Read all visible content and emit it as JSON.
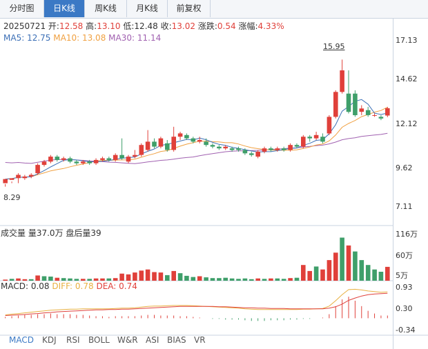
{
  "tabs": [
    {
      "label": "分时图",
      "active": false
    },
    {
      "label": "日K线",
      "active": true
    },
    {
      "label": "周K线",
      "active": false
    },
    {
      "label": "月K线",
      "active": false
    },
    {
      "label": "前复权",
      "active": false
    }
  ],
  "info": {
    "date": "20250721",
    "open_label": "开:",
    "open": "12.58",
    "high_label": "高:",
    "high": "13.10",
    "low_label": "低:",
    "low": "12.48",
    "close_label": "收:",
    "close": "13.02",
    "change_label": "涨跌:",
    "change": "0.54",
    "pct_label": "涨幅:",
    "pct": "4.33%"
  },
  "ma": {
    "ma5_label": "MA5:",
    "ma5": "12.75",
    "ma10_label": "MA10:",
    "ma10": "13.08",
    "ma30_label": "MA30:",
    "ma30": "11.14"
  },
  "volume": {
    "label": "成交量",
    "detail": "量37.0万",
    "after_label": "盘后量39"
  },
  "macd": {
    "macd_label": "MACD:",
    "macd": "0.08",
    "diff_label": "DIFF:",
    "diff": "0.78",
    "dea_label": "DEA:",
    "dea": "0.74"
  },
  "price_axis": [
    "17.13",
    "14.62",
    "12.12",
    "9.62",
    "7.11"
  ],
  "volume_axis": [
    "116万",
    "60万",
    "5万"
  ],
  "macd_axis": [
    "0.93",
    "0.30",
    "-0.34"
  ],
  "annotations": {
    "high_label": "15.95",
    "low_label": "8.29"
  },
  "bottom_tabs": [
    "MACD",
    "KDJ",
    "RSI",
    "BOLL",
    "W&R",
    "ASI",
    "BIAS",
    "VR"
  ],
  "colors": {
    "up": "#e0403a",
    "down": "#3f9f6a",
    "ma5": "#3b6fb6",
    "ma10": "#f0a040",
    "ma30": "#a060b0",
    "accent": "#3b79c5"
  },
  "chart_data": {
    "type": "candlestick",
    "price_range": [
      7.11,
      17.13
    ],
    "candles": [
      [
        8.5,
        8.75,
        8.45,
        8.29
      ],
      [
        8.7,
        8.8,
        8.6,
        8.5
      ],
      [
        8.8,
        9.0,
        9.1,
        8.5
      ],
      [
        8.8,
        8.9,
        9.0,
        8.7
      ],
      [
        8.9,
        9.0,
        9.1,
        8.8
      ],
      [
        9.1,
        9.6,
        9.7,
        9.0
      ],
      [
        9.6,
        9.8,
        9.9,
        9.5
      ],
      [
        9.8,
        10.1,
        10.2,
        9.7
      ],
      [
        10.1,
        9.9,
        10.2,
        9.8
      ],
      [
        9.9,
        10.0,
        10.1,
        9.8
      ],
      [
        10.0,
        9.8,
        10.1,
        9.7
      ],
      [
        9.8,
        9.7,
        9.9,
        9.6
      ],
      [
        9.7,
        9.8,
        9.9,
        9.6
      ],
      [
        9.8,
        9.7,
        9.9,
        9.6
      ],
      [
        9.7,
        9.9,
        10.0,
        9.6
      ],
      [
        9.9,
        10.0,
        10.1,
        9.8
      ],
      [
        10.0,
        9.9,
        10.1,
        9.8
      ],
      [
        9.9,
        10.2,
        10.3,
        9.8
      ],
      [
        10.2,
        10.0,
        11.2,
        9.9
      ],
      [
        9.8,
        10.1,
        10.2,
        9.7
      ],
      [
        10.1,
        10.2,
        10.5,
        10.0
      ],
      [
        10.2,
        10.8,
        10.9,
        10.1
      ],
      [
        10.5,
        11.0,
        11.7,
        10.4
      ],
      [
        11.0,
        10.7,
        11.2,
        10.6
      ],
      [
        10.7,
        11.2,
        11.3,
        10.6
      ],
      [
        10.9,
        10.5,
        11.1,
        10.4
      ],
      [
        10.5,
        11.3,
        11.9,
        10.4
      ],
      [
        11.3,
        11.5,
        11.6,
        11.1
      ],
      [
        11.4,
        11.2,
        11.5,
        11.1
      ],
      [
        11.2,
        11.0,
        11.3,
        10.9
      ],
      [
        11.0,
        11.1,
        11.3,
        10.9
      ],
      [
        11.0,
        10.8,
        11.2,
        10.7
      ],
      [
        10.8,
        10.7,
        10.9,
        10.6
      ],
      [
        10.7,
        10.6,
        10.8,
        10.5
      ],
      [
        10.6,
        10.7,
        10.8,
        10.5
      ],
      [
        10.6,
        10.5,
        10.7,
        10.4
      ],
      [
        10.6,
        10.5,
        10.7,
        10.4
      ],
      [
        10.5,
        10.3,
        10.6,
        10.2
      ],
      [
        10.3,
        10.2,
        10.4,
        10.1
      ],
      [
        10.1,
        10.4,
        10.5,
        10.0
      ],
      [
        10.4,
        10.6,
        10.7,
        10.3
      ],
      [
        10.6,
        10.5,
        10.7,
        10.4
      ],
      [
        10.5,
        10.6,
        10.7,
        10.4
      ],
      [
        10.6,
        10.5,
        10.7,
        10.4
      ],
      [
        10.5,
        10.8,
        10.9,
        10.4
      ],
      [
        10.8,
        10.7,
        10.9,
        10.6
      ],
      [
        10.7,
        11.3,
        11.4,
        10.6
      ],
      [
        11.3,
        11.2,
        11.4,
        11.0
      ],
      [
        11.2,
        11.4,
        11.6,
        11.1
      ],
      [
        11.3,
        11.0,
        11.5,
        10.9
      ],
      [
        11.5,
        12.5,
        12.6,
        11.4
      ],
      [
        12.5,
        14.0,
        14.1,
        12.4
      ],
      [
        14.0,
        15.3,
        15.95,
        13.9
      ],
      [
        13.9,
        12.8,
        15.3,
        12.7
      ],
      [
        13.9,
        12.6,
        14.1,
        12.5
      ],
      [
        12.8,
        13.0,
        13.2,
        12.6
      ],
      [
        12.9,
        12.6,
        13.1,
        12.5
      ],
      [
        12.6,
        12.6,
        12.7,
        12.5
      ],
      [
        12.5,
        12.4,
        12.6,
        12.3
      ],
      [
        12.58,
        13.02,
        13.1,
        12.48
      ]
    ],
    "volume_range": [
      0,
      116
    ],
    "volume": [
      3,
      5,
      6,
      4,
      4,
      14,
      12,
      11,
      8,
      7,
      6,
      5,
      5,
      5,
      6,
      6,
      6,
      7,
      19,
      17,
      22,
      27,
      30,
      23,
      22,
      15,
      26,
      20,
      13,
      10,
      12,
      9,
      7,
      7,
      8,
      6,
      5,
      6,
      4,
      6,
      5,
      6,
      6,
      5,
      7,
      8,
      42,
      26,
      38,
      30,
      55,
      75,
      115,
      94,
      78,
      55,
      42,
      30,
      24,
      37
    ],
    "volume_colors": [
      "up",
      "down",
      "up",
      "up",
      "down",
      "up",
      "down",
      "down",
      "up",
      "down",
      "down",
      "down",
      "up",
      "down",
      "up",
      "up",
      "down",
      "up",
      "up",
      "up",
      "up",
      "up",
      "up",
      "up",
      "up",
      "down",
      "up",
      "down",
      "down",
      "down",
      "up",
      "down",
      "down",
      "down",
      "down",
      "down",
      "down",
      "down",
      "down",
      "up",
      "down",
      "up",
      "down",
      "down",
      "up",
      "down",
      "up",
      "up",
      "down",
      "up",
      "up",
      "up",
      "down",
      "up",
      "down",
      "down",
      "down",
      "down",
      "down",
      "up"
    ],
    "macd_range": [
      -0.34,
      0.93
    ],
    "diff": [
      0.1,
      0.12,
      0.14,
      0.16,
      0.18,
      0.2,
      0.22,
      0.24,
      0.25,
      0.26,
      0.27,
      0.27,
      0.28,
      0.28,
      0.28,
      0.28,
      0.28,
      0.29,
      0.3,
      0.3,
      0.31,
      0.33,
      0.35,
      0.36,
      0.36,
      0.37,
      0.38,
      0.38,
      0.38,
      0.37,
      0.36,
      0.35,
      0.34,
      0.33,
      0.32,
      0.31,
      0.3,
      0.28,
      0.27,
      0.26,
      0.26,
      0.26,
      0.26,
      0.26,
      0.26,
      0.26,
      0.27,
      0.27,
      0.28,
      0.29,
      0.36,
      0.52,
      0.7,
      0.85,
      0.86,
      0.84,
      0.81,
      0.79,
      0.77,
      0.78
    ],
    "dea": [
      0.08,
      0.09,
      0.1,
      0.11,
      0.13,
      0.14,
      0.16,
      0.17,
      0.19,
      0.2,
      0.21,
      0.22,
      0.23,
      0.24,
      0.25,
      0.25,
      0.26,
      0.26,
      0.27,
      0.27,
      0.28,
      0.29,
      0.3,
      0.31,
      0.32,
      0.33,
      0.34,
      0.35,
      0.35,
      0.35,
      0.35,
      0.35,
      0.35,
      0.34,
      0.34,
      0.33,
      0.32,
      0.31,
      0.31,
      0.3,
      0.3,
      0.29,
      0.29,
      0.29,
      0.28,
      0.28,
      0.28,
      0.28,
      0.28,
      0.28,
      0.3,
      0.34,
      0.42,
      0.53,
      0.6,
      0.66,
      0.7,
      0.72,
      0.73,
      0.74
    ]
  }
}
